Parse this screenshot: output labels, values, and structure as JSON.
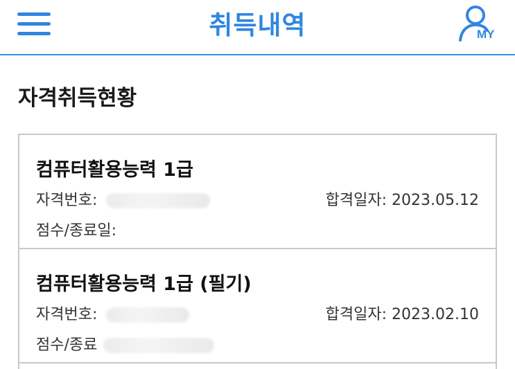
{
  "header": {
    "title": "취득내역",
    "my_label": "MY"
  },
  "section": {
    "title": "자격취득현황"
  },
  "cards": [
    {
      "name": "컴퓨터활용능력 1급",
      "number_label": "자격번호:",
      "date_label": "합격일자:",
      "date_value": "2023.05.12",
      "score_label": "점수/종료일:"
    },
    {
      "name": "컴퓨터활용능력 1급 (필기)",
      "number_label": "자격번호:",
      "date_label": "합격일자:",
      "date_value": "2023.02.10",
      "score_label": "점수/종료"
    }
  ],
  "colors": {
    "accent": "#2f86e0",
    "border": "#c8c8c8",
    "text": "#1a1a1a"
  },
  "icons": {
    "menu": "hamburger-menu-icon",
    "my": "user-icon"
  }
}
